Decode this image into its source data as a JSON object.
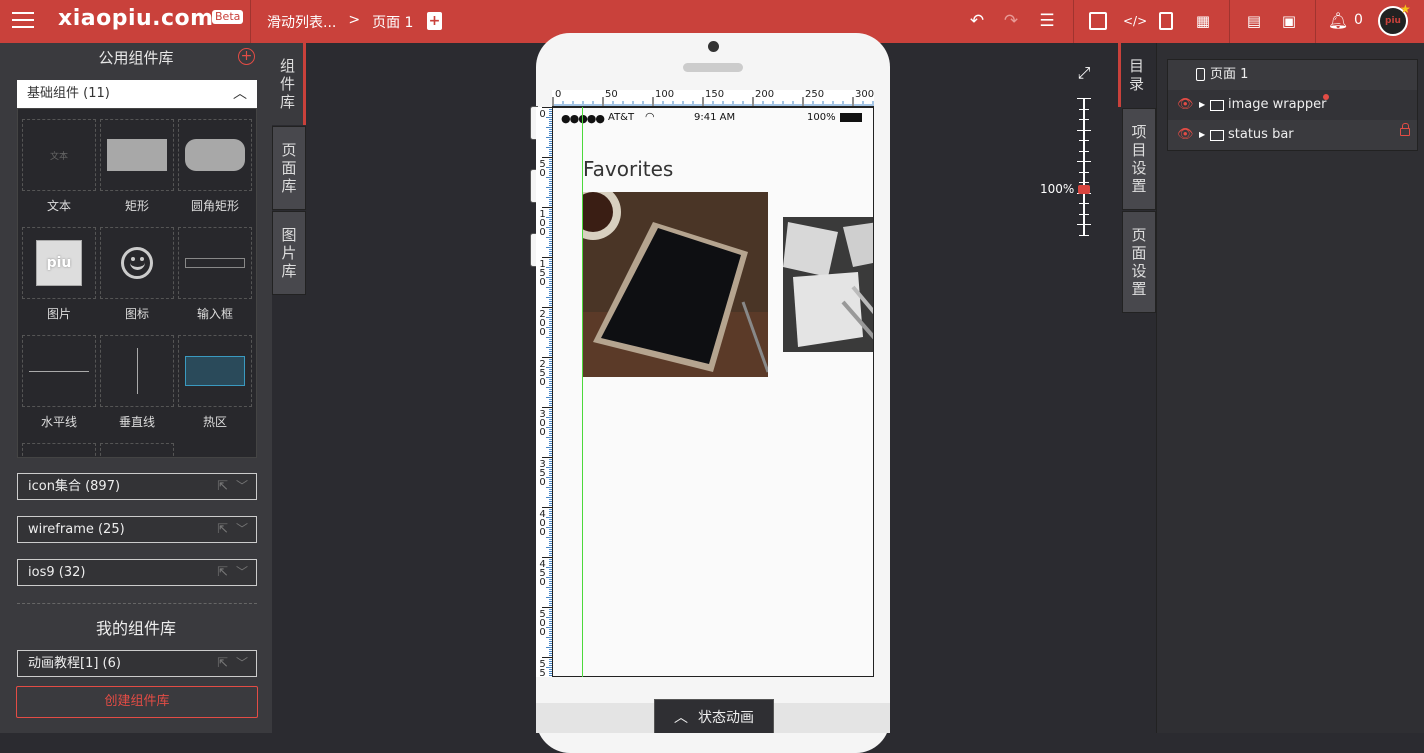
{
  "topbar": {
    "logo": "xiaopiu.com",
    "beta": "Beta",
    "breadcrumb": [
      "滑动列表...",
      ">",
      "页面 1"
    ],
    "notifications_count": "0",
    "avatar_text": "piu"
  },
  "left_panel": {
    "title": "公用组件库",
    "basic_group": "基础组件 (11)",
    "components": [
      {
        "label": "文本",
        "preview": "文本"
      },
      {
        "label": "矩形"
      },
      {
        "label": "圆角矩形"
      },
      {
        "label": "图片",
        "preview": "piu"
      },
      {
        "label": "图标"
      },
      {
        "label": "输入框"
      },
      {
        "label": "水平线"
      },
      {
        "label": "垂直线"
      },
      {
        "label": "热区"
      }
    ],
    "libraries": [
      {
        "label": "icon集合 (897)"
      },
      {
        "label": "wireframe (25)"
      },
      {
        "label": "ios9 (32)"
      }
    ],
    "my_lib_title": "我的组件库",
    "my_libraries": [
      {
        "label": "动画教程[1] (6)"
      }
    ],
    "create_lib": "创建组件库"
  },
  "left_tabs": {
    "components": [
      "组",
      "件",
      "库"
    ],
    "pages": [
      "页",
      "面",
      "库"
    ],
    "images": [
      "图",
      "片",
      "库"
    ]
  },
  "canvas": {
    "ruler_top": [
      "0",
      "50",
      "100",
      "150",
      "200",
      "250",
      "300"
    ],
    "ruler_left": [
      "0",
      "50",
      "100",
      "150",
      "200",
      "250",
      "300",
      "350",
      "400",
      "450",
      "500",
      "55"
    ],
    "statusbar": {
      "carrier": "AT&T",
      "time": "9:41 AM",
      "battery": "100%"
    },
    "title": "Favorites",
    "state_animation": "状态动画",
    "zoom_level": "100%"
  },
  "right_tabs": {
    "outline": [
      "目",
      "录"
    ],
    "project_settings": [
      "项",
      "目",
      "设",
      "置"
    ],
    "page_settings": [
      "页",
      "面",
      "设",
      "置"
    ]
  },
  "layers": {
    "page": "页面 1",
    "items": [
      {
        "label": "image wrapper"
      },
      {
        "label": "status bar"
      }
    ]
  },
  "colors": {
    "brand": "#c9413b",
    "guide": "#4cd93b"
  }
}
